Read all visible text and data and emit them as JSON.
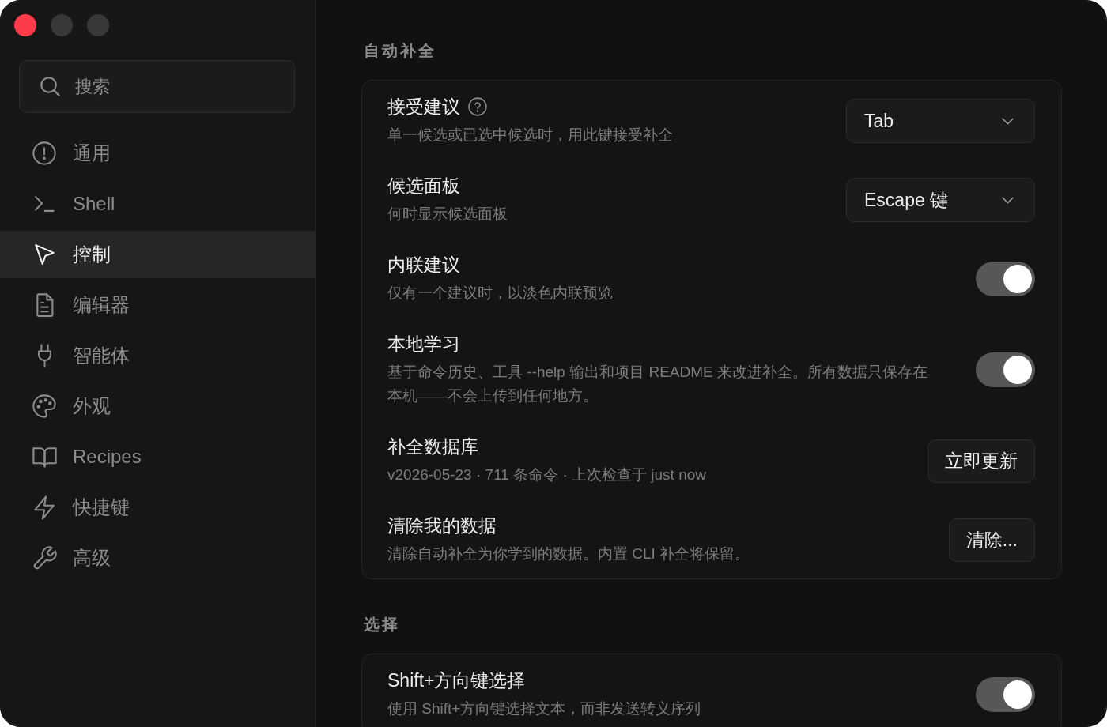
{
  "window": {
    "controls": [
      {
        "kind": "close",
        "disabled": false
      },
      {
        "kind": "minimize",
        "disabled": true
      },
      {
        "kind": "zoom",
        "disabled": true
      }
    ]
  },
  "sidebar": {
    "search": {
      "placeholder": "搜索"
    },
    "items": [
      {
        "label": "通用",
        "selected": false
      },
      {
        "label": "Shell",
        "selected": false
      },
      {
        "label": "控制",
        "selected": true
      },
      {
        "label": "编辑器",
        "selected": false
      },
      {
        "label": "智能体",
        "selected": false
      },
      {
        "label": "外观",
        "selected": false
      },
      {
        "label": "Recipes",
        "selected": false
      },
      {
        "label": "快捷键",
        "selected": false
      },
      {
        "label": "高级",
        "selected": false
      }
    ]
  },
  "sections": [
    {
      "title": "自动补全",
      "rows": [
        {
          "kind": "select",
          "title": "接受建议",
          "help_icon": true,
          "description": "单一候选或已选中候选时，用此键接受补全",
          "value": "Tab"
        },
        {
          "kind": "select",
          "title": "候选面板",
          "description": "何时显示候选面板",
          "value": "Escape 键"
        },
        {
          "kind": "toggle",
          "title": "内联建议",
          "description": "仅有一个建议时，以淡色内联预览",
          "on": true
        },
        {
          "kind": "toggle",
          "title": "本地学习",
          "description": "基于命令历史、工具 --help 输出和项目 README 来改进补全。所有数据只保存在本机——不会上传到任何地方。",
          "on": true
        },
        {
          "kind": "button",
          "title": "补全数据库",
          "description": "v2026-05-23 · 711 条命令 · 上次检查于 just now",
          "button": "立即更新"
        },
        {
          "kind": "button",
          "title": "清除我的数据",
          "description": "清除自动补全为你学到的数据。内置 CLI 补全将保留。",
          "button": "清除..."
        }
      ]
    },
    {
      "title": "选择",
      "rows": [
        {
          "kind": "toggle",
          "title": "Shift+方向键选择",
          "description": "使用 Shift+方向键选择文本，而非发送转义序列",
          "on": true
        }
      ]
    }
  ]
}
